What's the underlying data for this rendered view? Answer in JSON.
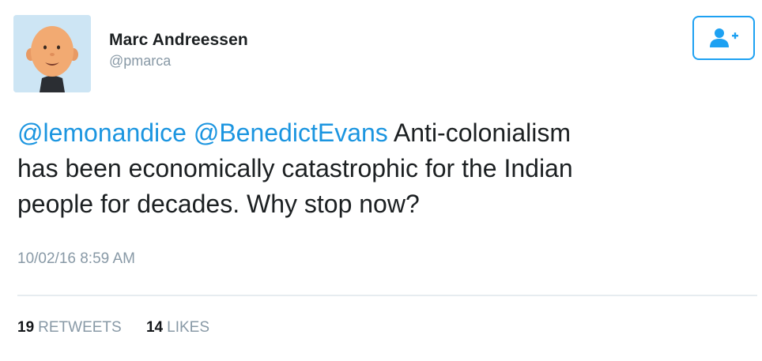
{
  "author": {
    "name": "Marc Andreessen",
    "handle": "@pmarca"
  },
  "follow_button": {
    "icon": "follow-user-icon"
  },
  "tweet": {
    "mention_1": "@lemonandice",
    "mention_2": "@BenedictEvans",
    "line_1_rest": "Anti-colonialism",
    "line_2": "has been economically catastrophic for the Indian",
    "line_3": "people for decades. Why stop now?"
  },
  "timestamp": "10/02/16 8:59 AM",
  "stats": {
    "retweets_count": "19",
    "retweets_label": "RETWEETS",
    "likes_count": "14",
    "likes_label": "LIKES"
  },
  "colors": {
    "accent": "#1da1f2",
    "mention": "#1b95e0",
    "muted": "#8899a6"
  }
}
